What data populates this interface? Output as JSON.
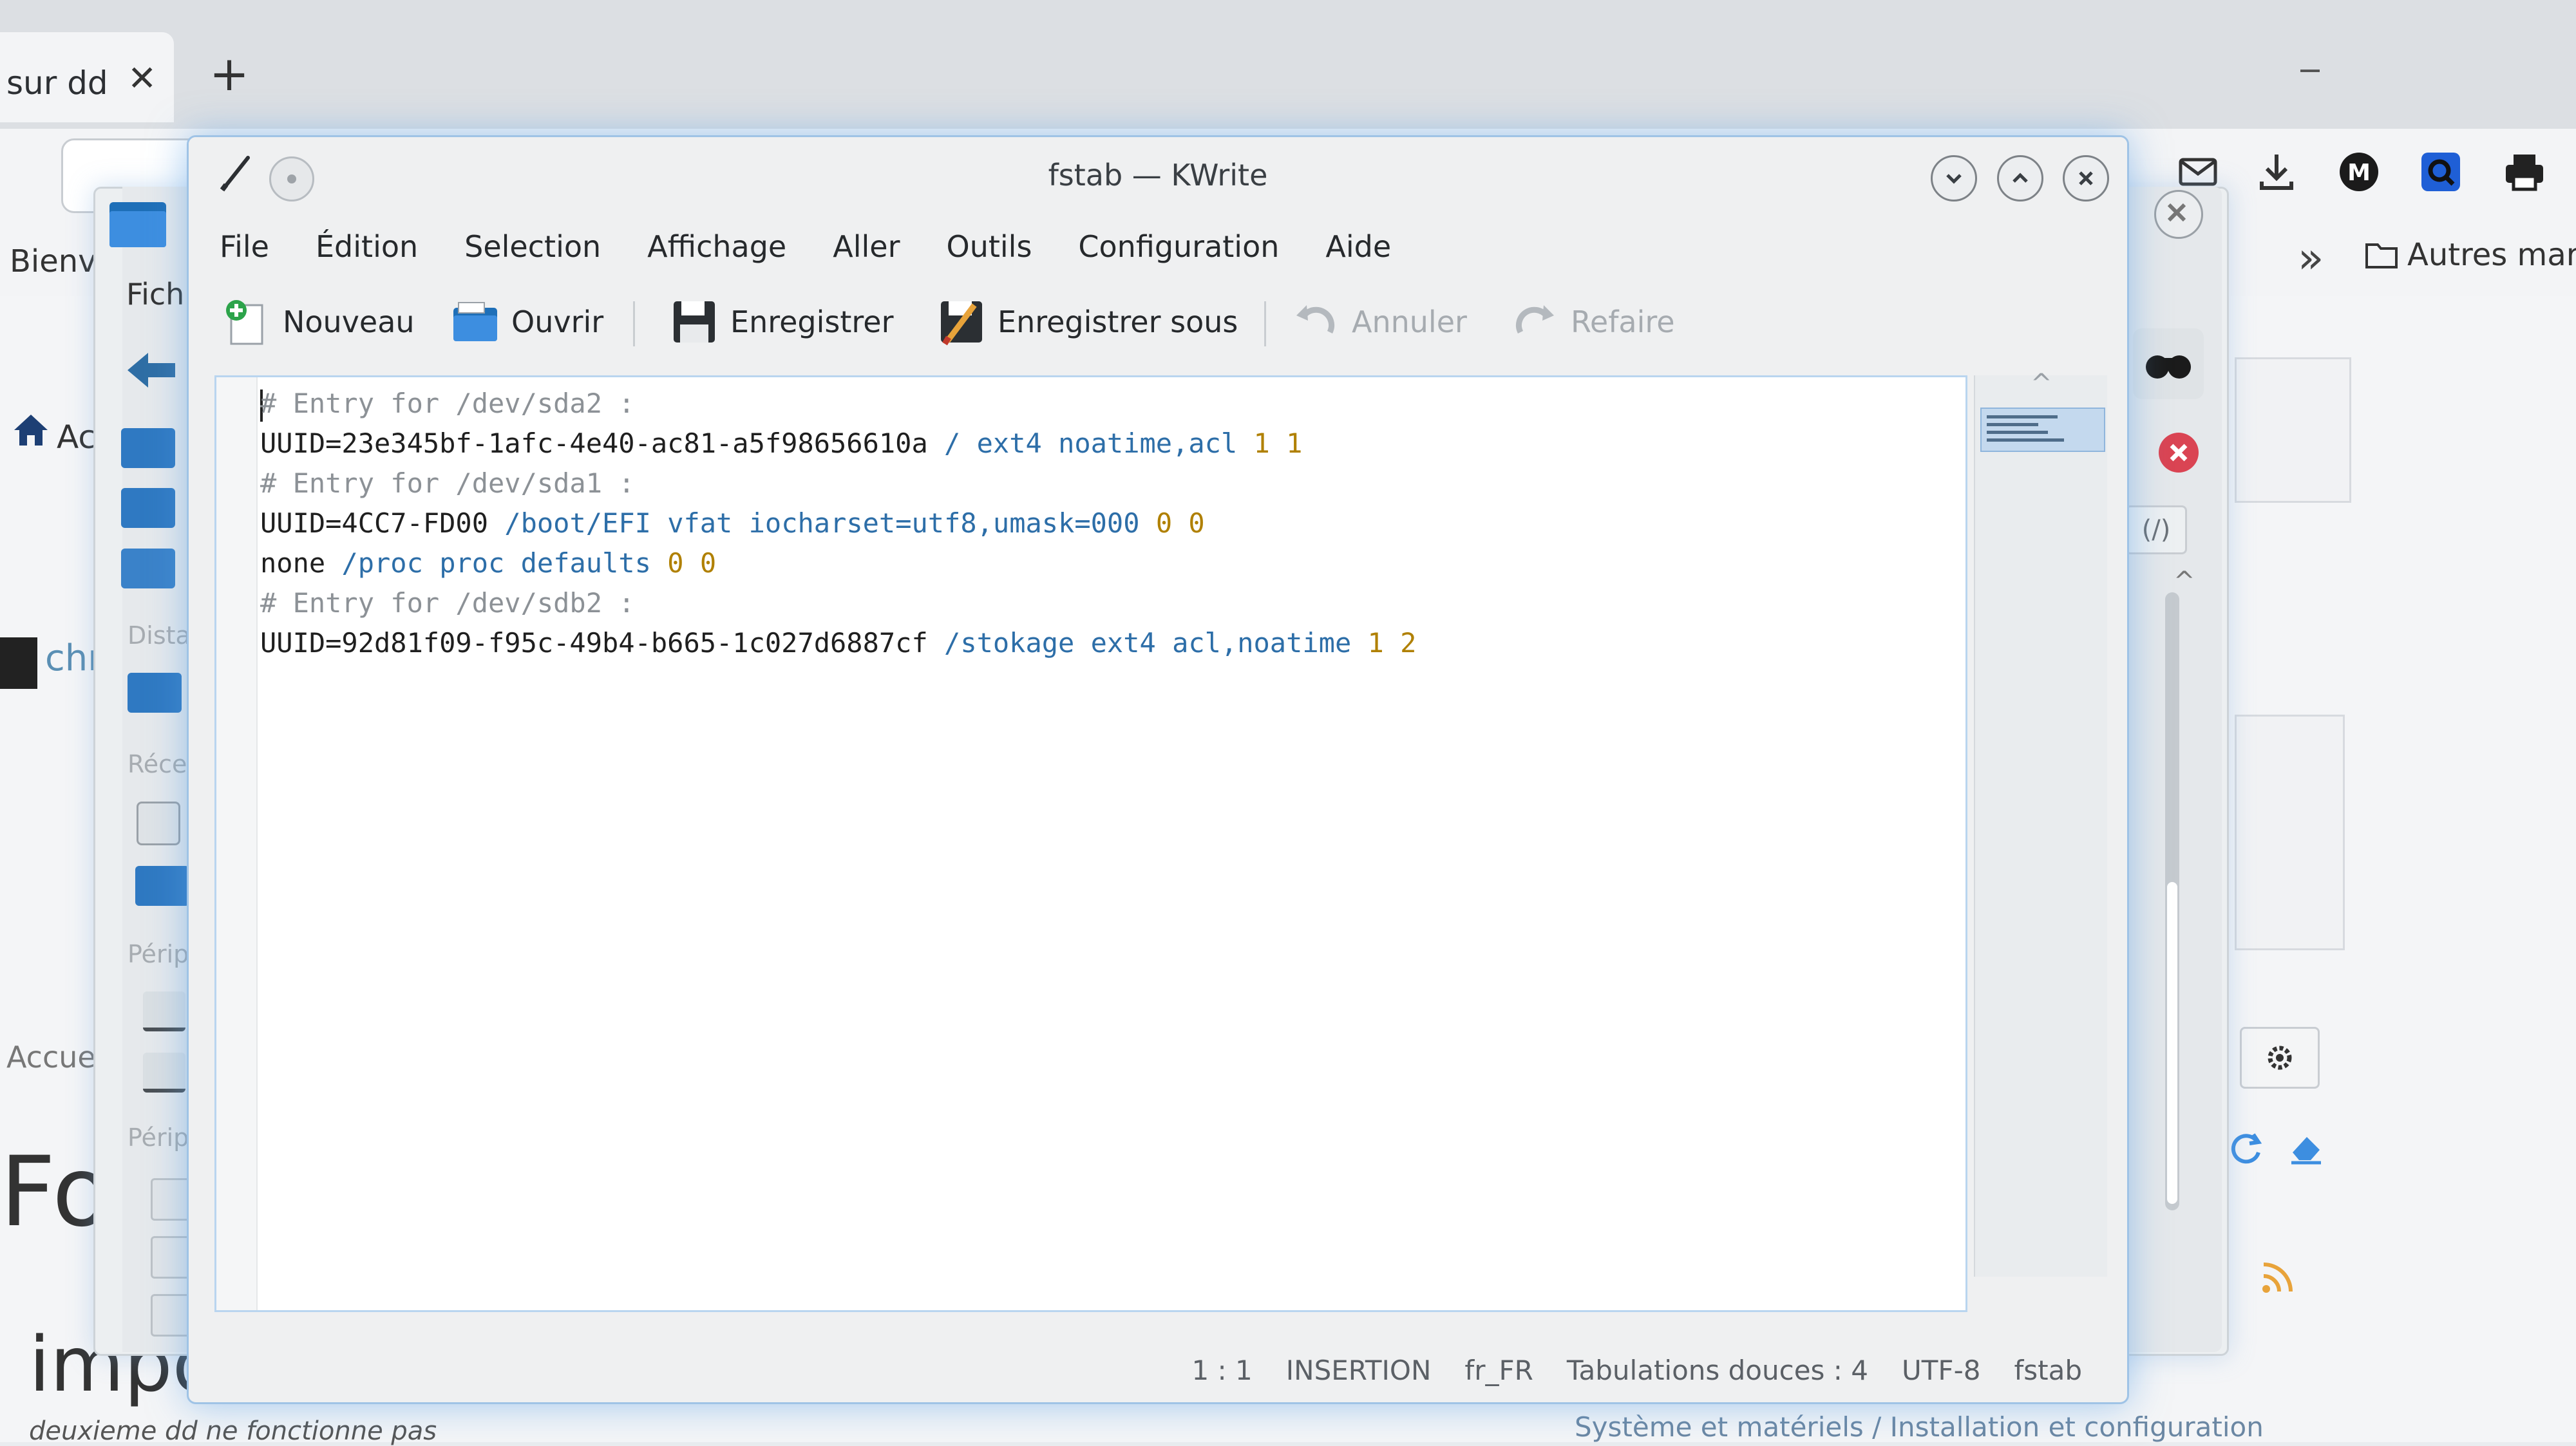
{
  "browser": {
    "tab_title": "sur dd",
    "tab_close": "✕",
    "new_tab": "+",
    "bookmark_welcome": "Bienv",
    "bookmark_more": "»",
    "bookmark_others": "Autres marc",
    "home_label": "Ac",
    "avatar_text": "chr",
    "breadcrumb_home": "Accueil",
    "forum_title": "For",
    "post_title": "impos",
    "post_subtitle": "deuxieme dd ne fonctionne pas",
    "category_path": "Système et matériels / Installation et configuration",
    "extension_badge": "M"
  },
  "dolphin": {
    "menu_label": "Fich",
    "section_remote": "Dista",
    "section_recent": "Réce",
    "section_devices": "Périp",
    "section_devices_2": "Périp",
    "filter_label": "(/)"
  },
  "kwrite": {
    "window_title": "fstab — KWrite",
    "menu": [
      "File",
      "Édition",
      "Selection",
      "Affichage",
      "Aller",
      "Outils",
      "Configuration",
      "Aide"
    ],
    "toolbar": {
      "new": "Nouveau",
      "open": "Ouvrir",
      "save": "Enregistrer",
      "save_as": "Enregistrer sous",
      "undo": "Annuler",
      "redo": "Refaire"
    },
    "editor_lines": [
      {
        "type": "comment",
        "text": "# Entry for /dev/sda2 :"
      },
      {
        "type": "entry",
        "device": "UUID=23e345bf-1afc-4e40-ac81-a5f98656610a",
        "mount": "/",
        "fstype": "ext4",
        "options": "noatime,acl",
        "dump": "1",
        "pass": "1"
      },
      {
        "type": "comment",
        "text": "# Entry for /dev/sda1 :"
      },
      {
        "type": "entry",
        "device": "UUID=4CC7-FD00",
        "mount": "/boot/EFI",
        "fstype": "vfat",
        "options": "iocharset=utf8,umask=000",
        "dump": "0",
        "pass": "0"
      },
      {
        "type": "entry",
        "device": "none",
        "mount": "/proc",
        "fstype": "proc",
        "options": "defaults",
        "dump": "0",
        "pass": "0"
      },
      {
        "type": "comment",
        "text": "# Entry for /dev/sdb2 :"
      },
      {
        "type": "entry",
        "device": "UUID=92d81f09-f95c-49b4-b665-1c027d6887cf",
        "mount": "/stokage",
        "fstype": "ext4",
        "options": "acl,noatime",
        "dump": "1",
        "pass": "2"
      }
    ],
    "status": {
      "position": "1 : 1",
      "mode": "INSERTION",
      "language": "fr_FR",
      "indent": "Tabulations douces : 4",
      "encoding": "UTF-8",
      "file_type": "fstab"
    }
  },
  "colors": {
    "accent": "#3d8ee0",
    "window_bg": "#eff0f1",
    "comment": "#8c9196",
    "keyword": "#2d6ea8",
    "number": "#b08000",
    "danger": "#da4453"
  }
}
